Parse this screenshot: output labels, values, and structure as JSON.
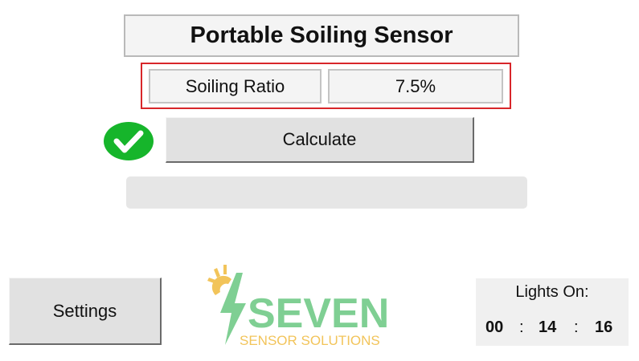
{
  "app": {
    "title": "Portable Soiling Sensor"
  },
  "measurement": {
    "label": "Soiling Ratio",
    "value": "7.5%"
  },
  "status": {
    "icon": "check-circle-icon",
    "color": "#16b52b"
  },
  "actions": {
    "calculate_label": "Calculate",
    "settings_label": "Settings"
  },
  "progress": {
    "value": 0
  },
  "logo": {
    "text_main": "SEVEN",
    "text_sub": "SENSOR SOLUTIONS",
    "color_green": "#7fcf93",
    "color_gold": "#f2c45a"
  },
  "lights": {
    "title": "Lights On:",
    "hours": "00",
    "minutes": "14",
    "seconds": "16",
    "separator": ":"
  }
}
